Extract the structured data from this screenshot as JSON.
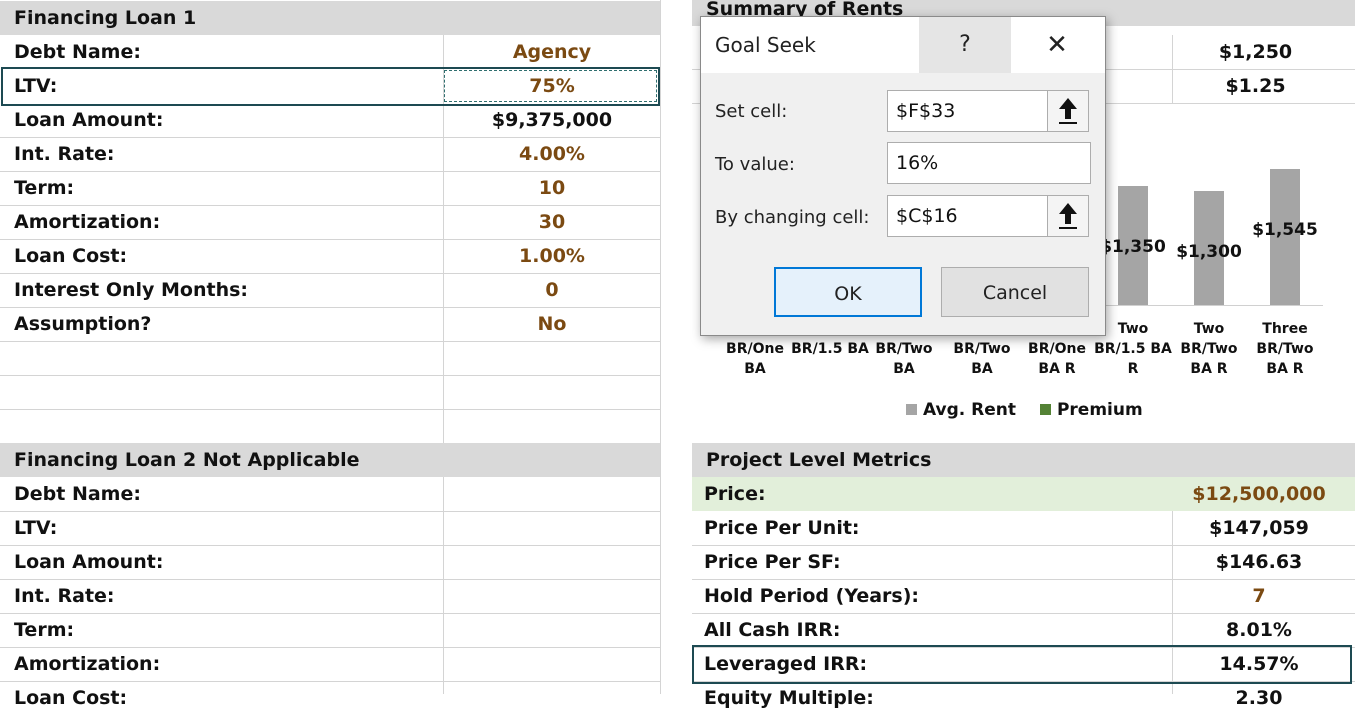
{
  "loan1": {
    "header": "Financing Loan 1",
    "rows": [
      {
        "label": "Debt Name:",
        "value": "Agency"
      },
      {
        "label": "LTV:",
        "value": "75%"
      },
      {
        "label": "Loan Amount:",
        "value": "$9,375,000"
      },
      {
        "label": "Int. Rate:",
        "value": "4.00%"
      },
      {
        "label": "Term:",
        "value": "10"
      },
      {
        "label": "Amortization:",
        "value": "30"
      },
      {
        "label": "Loan Cost:",
        "value": "1.00%"
      },
      {
        "label": "Interest Only Months:",
        "value": "0"
      },
      {
        "label": "Assumption?",
        "value": "No"
      }
    ]
  },
  "loan2": {
    "header": "Financing Loan 2 Not Applicable",
    "rows": [
      {
        "label": "Debt Name:"
      },
      {
        "label": "LTV:"
      },
      {
        "label": "Loan Amount:"
      },
      {
        "label": "Int. Rate:"
      },
      {
        "label": "Term:"
      },
      {
        "label": "Amortization:"
      },
      {
        "label": "Loan Cost:"
      }
    ]
  },
  "rents": {
    "header": "Summary of Rents",
    "values": [
      "$1,250",
      "$1.25"
    ]
  },
  "metrics": {
    "header": "Project Level Metrics",
    "rows": [
      {
        "label": "Price:",
        "value": "$12,500,000"
      },
      {
        "label": "Price Per Unit:",
        "value": "$147,059"
      },
      {
        "label": "Price Per SF:",
        "value": "$146.63"
      },
      {
        "label": "Hold Period (Years):",
        "value": "7"
      },
      {
        "label": "All Cash IRR:",
        "value": "8.01%"
      },
      {
        "label": "Leveraged IRR:",
        "value": "14.57%"
      },
      {
        "label": "Equity Multiple:",
        "value": "2.30"
      }
    ]
  },
  "chart_data": {
    "type": "bar",
    "categories": [
      "BR/One BA",
      "BR/1.5 BA",
      "BR/Two BA",
      "BR/Two BA",
      "BR/One BA R",
      "Two BR/1.5 BA R",
      "Two BR/Two BA R",
      "Three BR/Two BA R"
    ],
    "series": [
      {
        "name": "Avg. Rent",
        "values": [
          null,
          null,
          null,
          null,
          null,
          1350,
          1300,
          1545
        ]
      },
      {
        "name": "Premium",
        "values": [
          null,
          null,
          null,
          null,
          null,
          null,
          null,
          null
        ]
      }
    ],
    "data_labels": [
      "$1,350",
      "$1,300",
      "$1,545"
    ],
    "legend": "bottom",
    "colors": {
      "avg_rent": "#a5a5a5",
      "premium": "#548235"
    }
  },
  "goal_seek": {
    "title": "Goal Seek",
    "help": "?",
    "close": "✕",
    "set_cell_label": "Set cell:",
    "set_cell_value": "$F$33",
    "to_value_label": "To value:",
    "to_value_value": "16%",
    "by_changing_label": "By changing cell:",
    "by_changing_value": "$C$16",
    "ok_label": "OK",
    "cancel_label": "Cancel"
  }
}
